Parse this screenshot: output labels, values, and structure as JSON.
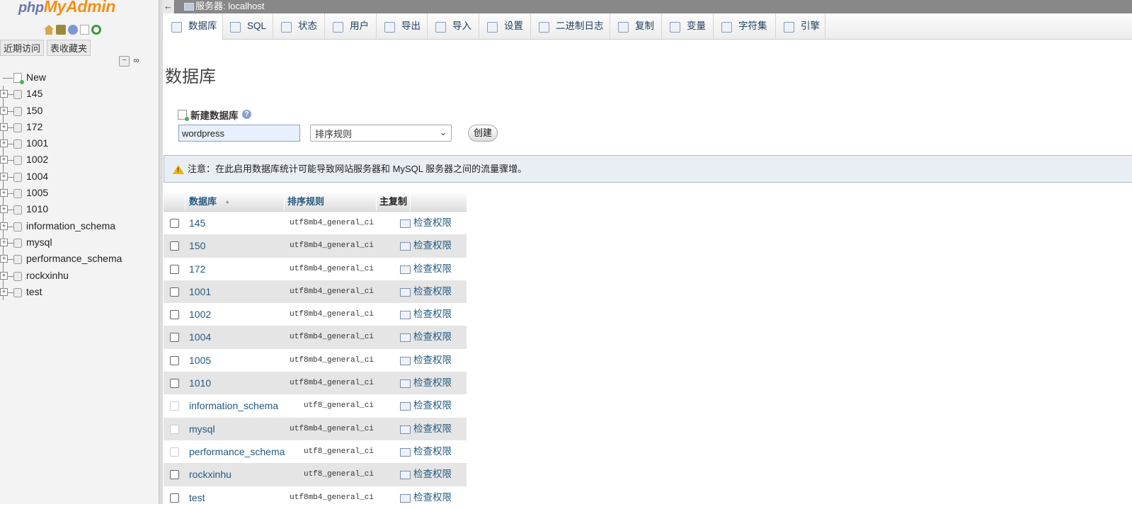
{
  "logo": {
    "php": "php",
    "my": "My",
    "admin": "Admin"
  },
  "nav": {
    "tabs": [
      "近期访问",
      "表收藏夹"
    ],
    "new_label": "New",
    "databases": [
      "145",
      "150",
      "172",
      "1001",
      "1002",
      "1004",
      "1005",
      "1010",
      "information_schema",
      "mysql",
      "performance_schema",
      "rockxinhu",
      "test"
    ]
  },
  "serverbar": {
    "back": "←",
    "server": "服务器: localhost"
  },
  "topmenu": [
    {
      "label": "数据库",
      "icon": "database-icon",
      "active": true
    },
    {
      "label": "SQL",
      "icon": "sql-icon"
    },
    {
      "label": "状态",
      "icon": "status-icon"
    },
    {
      "label": "用户",
      "icon": "users-icon"
    },
    {
      "label": "导出",
      "icon": "export-icon"
    },
    {
      "label": "导入",
      "icon": "import-icon"
    },
    {
      "label": "设置",
      "icon": "settings-icon"
    },
    {
      "label": "二进制日志",
      "icon": "binlog-icon"
    },
    {
      "label": "复制",
      "icon": "replication-icon"
    },
    {
      "label": "变量",
      "icon": "variables-icon"
    },
    {
      "label": "字符集",
      "icon": "charset-icon"
    },
    {
      "label": "引擎",
      "icon": "engine-icon"
    }
  ],
  "main": {
    "title": "数据库",
    "create": {
      "label": "新建数据库",
      "db_value": "wordpress",
      "collation_placeholder": "排序规则",
      "button": "创建"
    },
    "notice": "注意：在此启用数据库统计可能导致网站服务器和 MySQL 服务器之间的流量骤增。",
    "table": {
      "headers": {
        "database": "数据库",
        "sort_arrow": "▲",
        "collation": "排序规则",
        "master": "主复制"
      },
      "rows": [
        {
          "name": "145",
          "collation": "utf8mb4_general_ci",
          "action": "检查权限",
          "disabled": false
        },
        {
          "name": "150",
          "collation": "utf8mb4_general_ci",
          "action": "检查权限",
          "disabled": false
        },
        {
          "name": "172",
          "collation": "utf8mb4_general_ci",
          "action": "检查权限",
          "disabled": false
        },
        {
          "name": "1001",
          "collation": "utf8mb4_general_ci",
          "action": "检查权限",
          "disabled": false
        },
        {
          "name": "1002",
          "collation": "utf8mb4_general_ci",
          "action": "检查权限",
          "disabled": false
        },
        {
          "name": "1004",
          "collation": "utf8mb4_general_ci",
          "action": "检查权限",
          "disabled": false
        },
        {
          "name": "1005",
          "collation": "utf8mb4_general_ci",
          "action": "检查权限",
          "disabled": false
        },
        {
          "name": "1010",
          "collation": "utf8mb4_general_ci",
          "action": "检查权限",
          "disabled": false
        },
        {
          "name": "information_schema",
          "collation": "utf8_general_ci",
          "action": "检查权限",
          "disabled": true
        },
        {
          "name": "mysql",
          "collation": "utf8mb4_general_ci",
          "action": "检查权限",
          "disabled": true
        },
        {
          "name": "performance_schema",
          "collation": "utf8_general_ci",
          "action": "检查权限",
          "disabled": true
        },
        {
          "name": "rockxinhu",
          "collation": "utf8_general_ci",
          "action": "检查权限",
          "disabled": false
        },
        {
          "name": "test",
          "collation": "utf8mb4_general_ci",
          "action": "检查权限",
          "disabled": false
        }
      ]
    }
  }
}
